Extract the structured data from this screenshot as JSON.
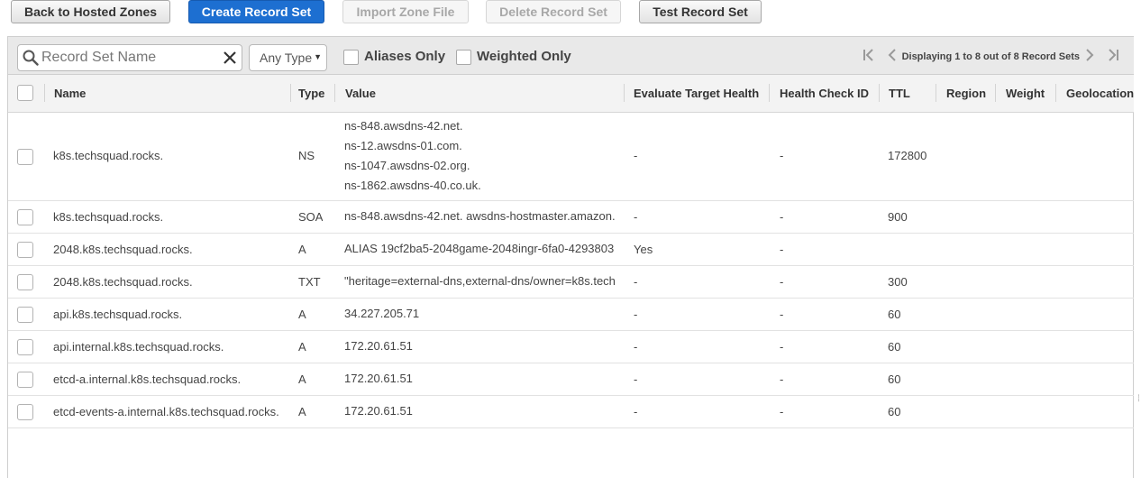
{
  "toolbar": {
    "back_label": "Back to Hosted Zones",
    "create_label": "Create Record Set",
    "import_label": "Import Zone File",
    "delete_label": "Delete Record Set",
    "test_label": "Test Record Set"
  },
  "filters": {
    "search_placeholder": "Record Set Name",
    "type_selected": "Any Type",
    "aliases_only": "Aliases Only",
    "weighted_only": "Weighted Only",
    "pagination": "Displaying 1 to 8 out of 8 Record Sets"
  },
  "columns": {
    "name": "Name",
    "type": "Type",
    "value": "Value",
    "eval": "Evaluate Target Health",
    "health": "Health Check ID",
    "ttl": "TTL",
    "region": "Region",
    "weight": "Weight",
    "geo": "Geolocation"
  },
  "rows": [
    {
      "name": "k8s.techsquad.rocks.",
      "type": "NS",
      "values": [
        "ns-848.awsdns-42.net.",
        "ns-12.awsdns-01.com.",
        "ns-1047.awsdns-02.org.",
        "ns-1862.awsdns-40.co.uk."
      ],
      "eval": "-",
      "health": "-",
      "ttl": "172800"
    },
    {
      "name": "k8s.techsquad.rocks.",
      "type": "SOA",
      "values": [
        "ns-848.awsdns-42.net. awsdns-hostmaster.amazon."
      ],
      "eval": "-",
      "health": "-",
      "ttl": "900"
    },
    {
      "name": "2048.k8s.techsquad.rocks.",
      "type": "A",
      "values": [
        "ALIAS 19cf2ba5-2048game-2048ingr-6fa0-4293803"
      ],
      "eval": "Yes",
      "health": "-",
      "ttl": ""
    },
    {
      "name": "2048.k8s.techsquad.rocks.",
      "type": "TXT",
      "values": [
        "\"heritage=external-dns,external-dns/owner=k8s.tech"
      ],
      "eval": "-",
      "health": "-",
      "ttl": "300"
    },
    {
      "name": "api.k8s.techsquad.rocks.",
      "type": "A",
      "values": [
        "34.227.205.71"
      ],
      "eval": "-",
      "health": "-",
      "ttl": "60"
    },
    {
      "name": "api.internal.k8s.techsquad.rocks.",
      "type": "A",
      "values": [
        "172.20.61.51"
      ],
      "eval": "-",
      "health": "-",
      "ttl": "60"
    },
    {
      "name": "etcd-a.internal.k8s.techsquad.rocks.",
      "type": "A",
      "values": [
        "172.20.61.51"
      ],
      "eval": "-",
      "health": "-",
      "ttl": "60"
    },
    {
      "name": "etcd-events-a.internal.k8s.techsquad.rocks.",
      "type": "A",
      "values": [
        "172.20.61.51"
      ],
      "eval": "-",
      "health": "-",
      "ttl": "60"
    }
  ]
}
